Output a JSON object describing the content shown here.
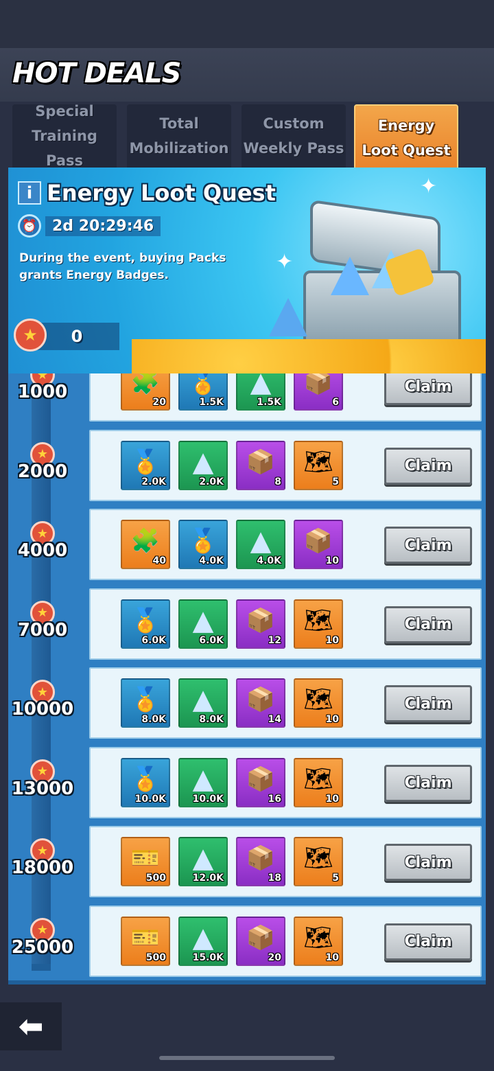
{
  "header": {
    "title": "HOT DEALS"
  },
  "tabs": [
    {
      "label": "Special\nTraining Pass",
      "active": false
    },
    {
      "label": "Total\nMobilization",
      "active": false
    },
    {
      "label": "Custom\nWeekly Pass",
      "active": false
    },
    {
      "label": "Energy\nLoot Quest",
      "active": true
    }
  ],
  "banner": {
    "title": "Energy Loot Quest",
    "timer": "2d 20:29:46",
    "description": "During the event, buying Packs grants Energy Badges.",
    "badge_count": "0"
  },
  "tiers": [
    {
      "milestone": "1000",
      "items": [
        {
          "icon": "puzzle-piece",
          "color": "orange",
          "qty": "20"
        },
        {
          "icon": "medal",
          "color": "blue",
          "qty": "1.5K"
        },
        {
          "icon": "crystal",
          "color": "green",
          "qty": "1.5K"
        },
        {
          "icon": "gold-crate",
          "color": "purple",
          "qty": "6"
        }
      ],
      "button": "Claim"
    },
    {
      "milestone": "2000",
      "items": [
        {
          "icon": "medal",
          "color": "blue",
          "qty": "2.0K"
        },
        {
          "icon": "crystal",
          "color": "green",
          "qty": "2.0K"
        },
        {
          "icon": "gold-crate",
          "color": "purple",
          "qty": "8"
        },
        {
          "icon": "blueprint",
          "color": "orange",
          "qty": "5"
        }
      ],
      "button": "Claim"
    },
    {
      "milestone": "4000",
      "items": [
        {
          "icon": "puzzle-piece",
          "color": "orange",
          "qty": "40"
        },
        {
          "icon": "medal",
          "color": "blue",
          "qty": "4.0K"
        },
        {
          "icon": "crystal",
          "color": "green",
          "qty": "4.0K"
        },
        {
          "icon": "gold-crate",
          "color": "purple",
          "qty": "10"
        }
      ],
      "button": "Claim"
    },
    {
      "milestone": "7000",
      "items": [
        {
          "icon": "medal",
          "color": "blue",
          "qty": "6.0K"
        },
        {
          "icon": "crystal",
          "color": "green",
          "qty": "6.0K"
        },
        {
          "icon": "gold-crate",
          "color": "purple",
          "qty": "12"
        },
        {
          "icon": "blueprint",
          "color": "orange",
          "qty": "10"
        }
      ],
      "button": "Claim"
    },
    {
      "milestone": "10000",
      "items": [
        {
          "icon": "medal",
          "color": "blue",
          "qty": "8.0K"
        },
        {
          "icon": "crystal",
          "color": "green",
          "qty": "8.0K"
        },
        {
          "icon": "gold-crate",
          "color": "purple",
          "qty": "14"
        },
        {
          "icon": "blueprint",
          "color": "orange",
          "qty": "10"
        }
      ],
      "button": "Claim"
    },
    {
      "milestone": "13000",
      "items": [
        {
          "icon": "medal",
          "color": "blue",
          "qty": "10.0K"
        },
        {
          "icon": "crystal",
          "color": "green",
          "qty": "10.0K"
        },
        {
          "icon": "gold-crate",
          "color": "purple",
          "qty": "16"
        },
        {
          "icon": "blueprint",
          "color": "orange",
          "qty": "10"
        }
      ],
      "button": "Claim"
    },
    {
      "milestone": "18000",
      "items": [
        {
          "icon": "ticket",
          "color": "orange",
          "qty": "500"
        },
        {
          "icon": "crystal",
          "color": "green",
          "qty": "12.0K"
        },
        {
          "icon": "gold-crate",
          "color": "purple",
          "qty": "18"
        },
        {
          "icon": "blueprint",
          "color": "orange",
          "qty": "5"
        }
      ],
      "button": "Claim"
    },
    {
      "milestone": "25000",
      "items": [
        {
          "icon": "ticket",
          "color": "orange",
          "qty": "500"
        },
        {
          "icon": "crystal",
          "color": "green",
          "qty": "15.0K"
        },
        {
          "icon": "gold-crate",
          "color": "purple",
          "qty": "20"
        },
        {
          "icon": "blueprint",
          "color": "orange",
          "qty": "10"
        }
      ],
      "button": "Claim"
    }
  ],
  "icons": {
    "info": "i",
    "timer": "⏰",
    "badge": "★",
    "back": "⬅",
    "puzzle-piece": "🧩",
    "medal": "🏅",
    "crystal": "▲",
    "gold-crate": "📦",
    "blueprint": "🗺",
    "ticket": "🎫"
  }
}
